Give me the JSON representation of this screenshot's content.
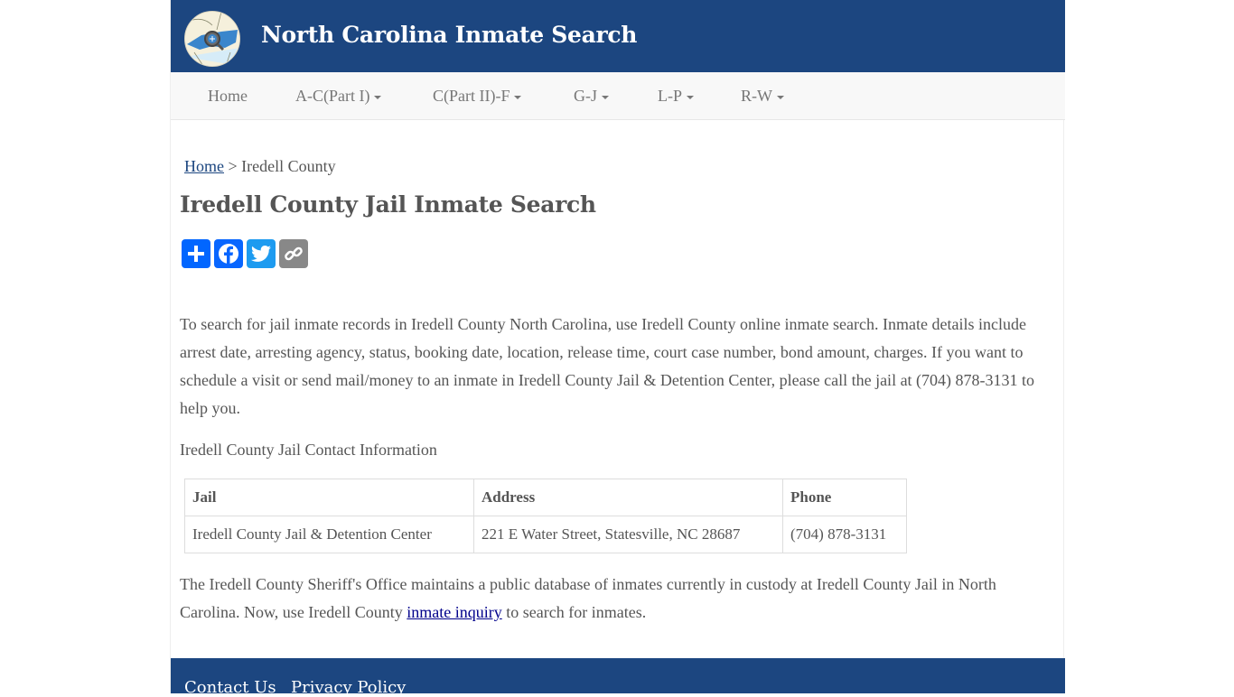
{
  "header": {
    "site_title": "North Carolina Inmate Search",
    "logo_icon": "nc-map-magnifier-logo"
  },
  "nav": {
    "items": [
      {
        "label": "Home",
        "dropdown": false
      },
      {
        "label": "A-C(Part I)",
        "dropdown": true
      },
      {
        "label": "C(Part II)-F",
        "dropdown": true
      },
      {
        "label": "G-J",
        "dropdown": true
      },
      {
        "label": "L-P",
        "dropdown": true
      },
      {
        "label": "R-W",
        "dropdown": true
      }
    ]
  },
  "breadcrumb": {
    "home": "Home",
    "separator": ">",
    "current": "Iredell County"
  },
  "page_title": "Iredell County Jail Inmate Search",
  "share": {
    "buttons": [
      {
        "name": "share",
        "icon": "plus-icon",
        "color": "#0166ff"
      },
      {
        "name": "facebook",
        "icon": "facebook-icon",
        "color": "#0866ff"
      },
      {
        "name": "twitter",
        "icon": "twitter-icon",
        "color": "#1d9bf0"
      },
      {
        "name": "copy-link",
        "icon": "link-icon",
        "color": "#888888"
      }
    ]
  },
  "content": {
    "intro": "To search for jail inmate records in Iredell County North Carolina, use Iredell County online inmate search. Inmate details include arrest date, arresting agency, status, booking date, location, release time, court case number, bond amount, charges. If you want to schedule a visit or send mail/money to an inmate in Iredell County Jail & Detention Center, please call the jail at (704) 878-3131 to help you.",
    "contact_heading": "Iredell County Jail Contact Information",
    "table": {
      "headers": [
        "Jail",
        "Address",
        "Phone"
      ],
      "rows": [
        [
          "Iredell County Jail & Detention Center",
          "221 E Water Street, Statesville, NC 28687",
          "(704) 878-3131"
        ]
      ]
    },
    "closing_before": "The Iredell County Sheriff's Office maintains a public database of inmates currently in custody at Iredell County Jail in North Carolina. Now, use Iredell County ",
    "closing_link": "inmate inquiry",
    "closing_after": " to search for inmates."
  },
  "footer": {
    "links": [
      "Contact Us",
      "Privacy Policy"
    ]
  },
  "colors": {
    "brand": "#1c4680",
    "nav_bg": "#f8f8f8",
    "text": "#555555",
    "link": "#00008b"
  }
}
